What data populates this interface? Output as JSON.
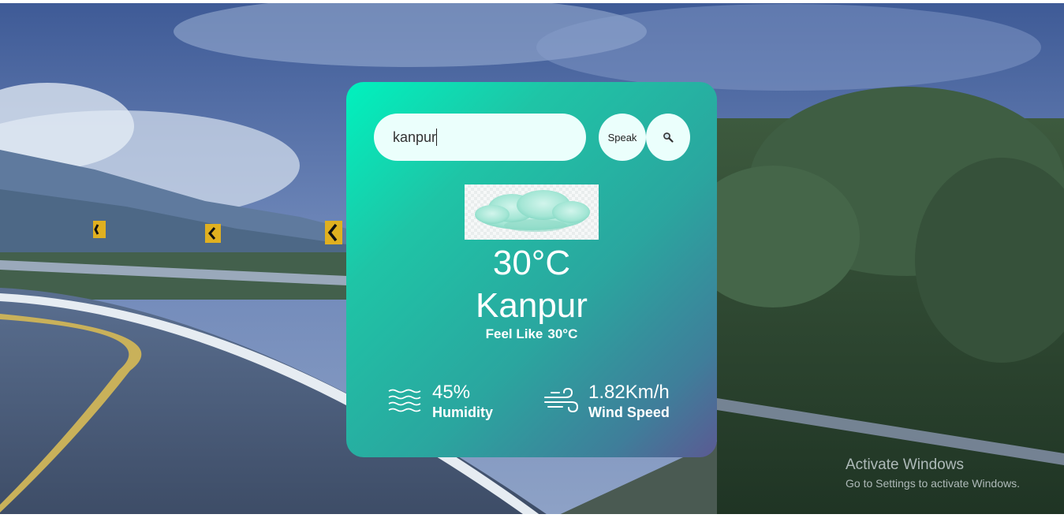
{
  "search": {
    "value": "kanpur",
    "speak_label": "Speak",
    "search_icon": "search-icon"
  },
  "weather": {
    "icon": "clouds-icon",
    "temperature": "30°C",
    "city": "Kanpur",
    "feels_like_label": "Feel Like",
    "feels_like_value": "30°C"
  },
  "stats": {
    "humidity": {
      "value": "45%",
      "label": "Humidity",
      "icon": "humidity-icon"
    },
    "wind": {
      "value": "1.82Km/h",
      "label": "Wind Speed",
      "icon": "wind-icon"
    }
  },
  "watermark": {
    "title": "Activate Windows",
    "subtitle": "Go to Settings to activate Windows."
  },
  "colors": {
    "card_gradient_start": "#00f2be",
    "card_gradient_end": "#5b5a93",
    "input_bg": "#ebfffc",
    "text": "#ffffff"
  }
}
